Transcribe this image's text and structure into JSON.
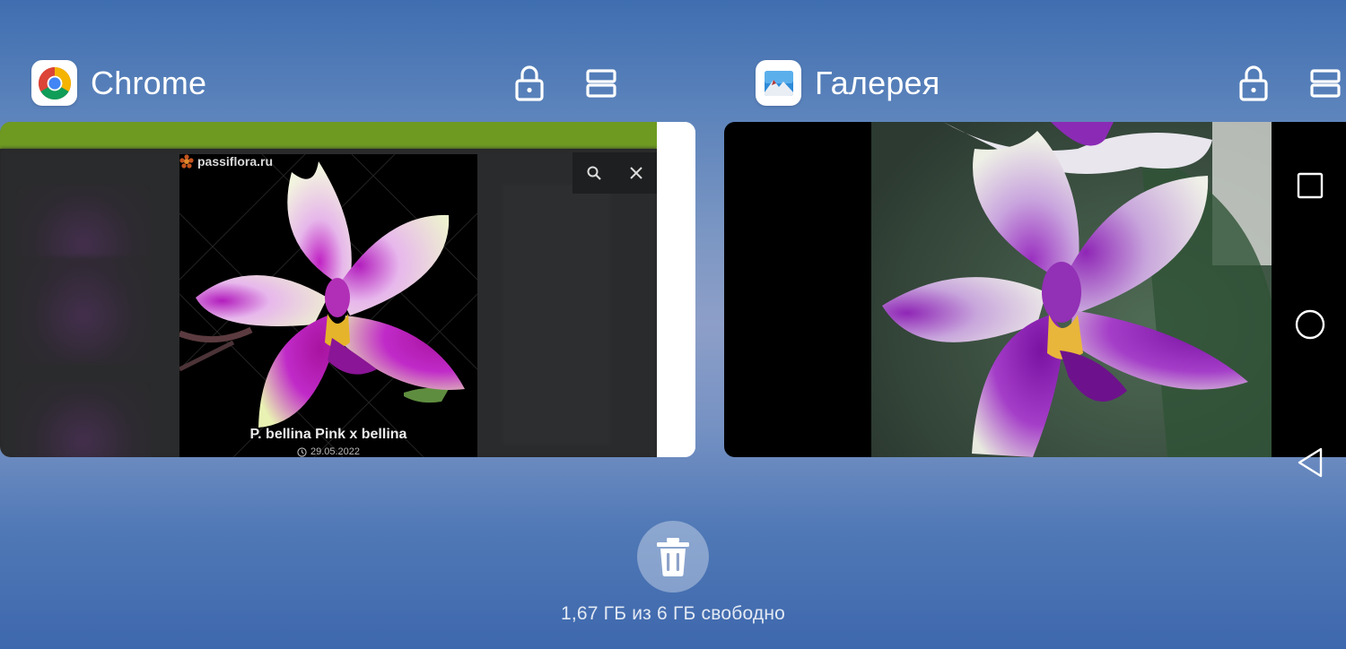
{
  "recents": {
    "cards": [
      {
        "app": "Chrome",
        "icon": "chrome-icon",
        "preview": {
          "site_label": "passiflora.ru",
          "caption": "P. bellina Pink x bellina",
          "date": "29.05.2022"
        }
      },
      {
        "app": "Галерея",
        "icon": "gallery-icon"
      }
    ]
  },
  "header_actions": [
    "lock-icon",
    "split-screen-icon"
  ],
  "nav_bar": [
    "recents-square-icon",
    "home-circle-icon",
    "back-triangle-icon"
  ],
  "clear_all": {
    "icon": "trash-icon"
  },
  "memory_status": "1,67 ГБ из 6 ГБ свободно",
  "colors": {
    "chrome_toolbar_green": "#6e9a22",
    "background_top": "#3f6eb0",
    "background_bottom": "#3e68ad"
  }
}
